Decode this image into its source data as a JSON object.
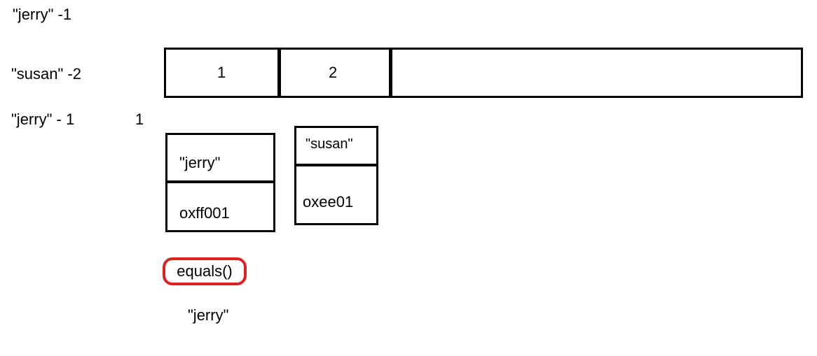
{
  "left_labels": {
    "row1": "\"jerry\"  -1",
    "row2": "\"susan\" -2",
    "row3": "\"jerry\" - 1",
    "floating_one": "1"
  },
  "array": {
    "cell1": "1",
    "cell2": "2"
  },
  "obj1": {
    "top_label": "\"jerry\"",
    "addr": "oxff001"
  },
  "obj2": {
    "top_label": "\"susan\"",
    "addr": "oxee01"
  },
  "method": {
    "name": "equals()"
  },
  "bottom_label": "\"jerry\""
}
